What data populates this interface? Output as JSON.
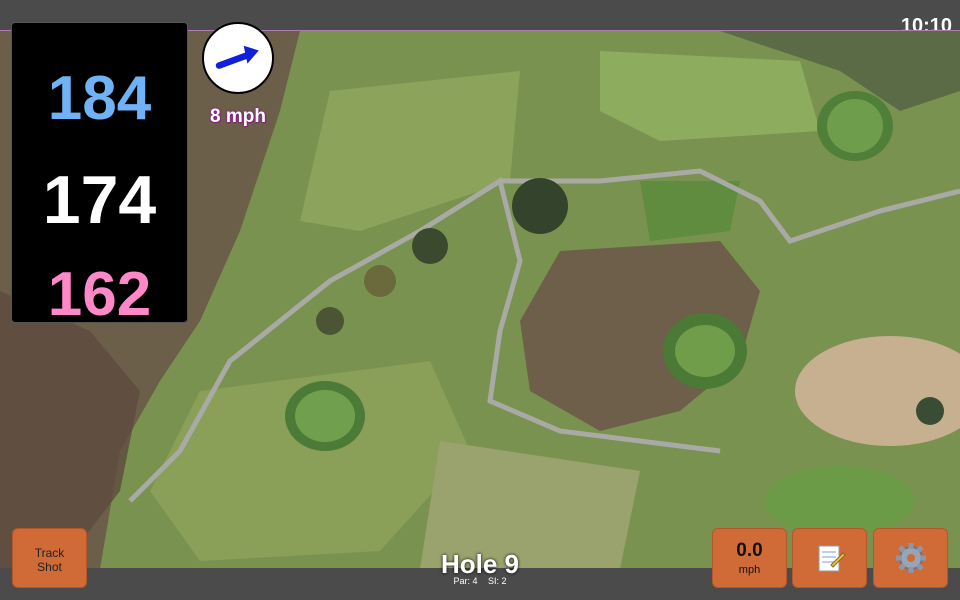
{
  "status": {
    "clock": "10:10"
  },
  "distances": {
    "back": "184",
    "middle": "174",
    "front": "162"
  },
  "wind": {
    "speed": "8 mph",
    "icon": "wind-arrow-icon"
  },
  "buttons": {
    "track_shot": [
      "Track",
      "Shot"
    ],
    "speed_value": "0.0",
    "speed_unit": "mph",
    "notes_icon": "notepad-icon",
    "settings_icon": "gear-icon"
  },
  "hole": {
    "title": "Hole 9",
    "par": "Par: 4",
    "si": "SI: 2"
  },
  "colors": {
    "accent_button": "#d06a36",
    "back_distance": "#6fb2f6",
    "middle_distance": "#ffffff",
    "front_distance": "#ff88c8"
  }
}
